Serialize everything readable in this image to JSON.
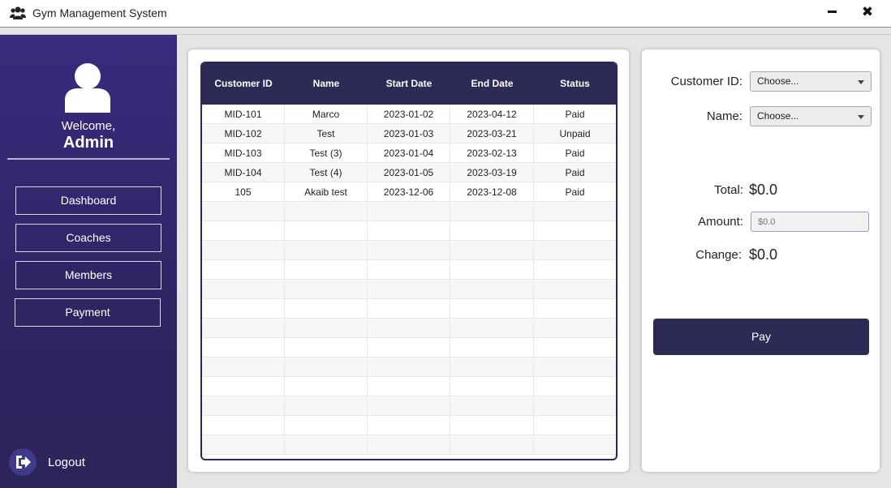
{
  "window": {
    "title": "Gym Management System",
    "minimize_icon": "minimize-icon",
    "close_icon": "close-icon",
    "close_glyph": "✖"
  },
  "sidebar": {
    "welcome": "Welcome,",
    "user": "Admin",
    "nav": [
      {
        "label": "Dashboard"
      },
      {
        "label": "Coaches"
      },
      {
        "label": "Members"
      },
      {
        "label": "Payment"
      }
    ],
    "logout": "Logout"
  },
  "table": {
    "columns": [
      "Customer ID",
      "Name",
      "Start Date",
      "End Date",
      "Status"
    ],
    "rows": [
      [
        "MID-101",
        "Marco",
        "2023-01-02",
        "2023-04-12",
        "Paid"
      ],
      [
        "MID-102",
        "Test",
        "2023-01-03",
        "2023-03-21",
        "Unpaid"
      ],
      [
        "MID-103",
        "Test (3)",
        "2023-01-04",
        "2023-02-13",
        "Paid"
      ],
      [
        "MID-104",
        "Test (4)",
        "2023-01-05",
        "2023-03-19",
        "Paid"
      ],
      [
        "105",
        "Akaib test",
        "2023-12-06",
        "2023-12-08",
        "Paid"
      ]
    ]
  },
  "payment": {
    "customer_id_label": "Customer ID:",
    "customer_id_value": "Choose...",
    "name_label": "Name:",
    "name_value": "Choose...",
    "total_label": "Total:",
    "total_value": "$0.0",
    "amount_label": "Amount:",
    "amount_placeholder": "$0.0",
    "change_label": "Change:",
    "change_value": "$0.0",
    "pay_button": "Pay"
  },
  "colors": {
    "sidebar_top": "#3a2a7e",
    "sidebar_bottom": "#2b2459",
    "header": "#2d2a56",
    "accent": "#2d2a56"
  }
}
